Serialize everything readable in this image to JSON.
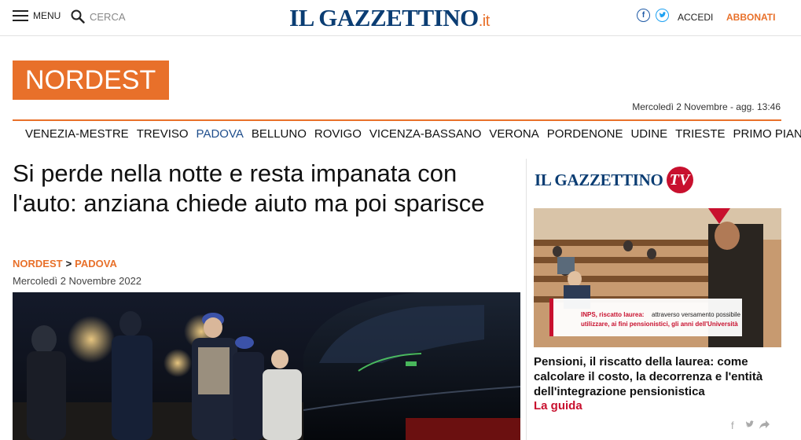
{
  "header": {
    "menu_label": "MENU",
    "search_placeholder": "CERCA",
    "logo_main": "IL GAZZETTINO",
    "logo_tld": ".it",
    "login_label": "ACCEDI",
    "subscribe_label": "ABBONATI"
  },
  "section": {
    "title": "NORDEST",
    "dateline": "Mercoledì 2 Novembre - agg. 13:46"
  },
  "subnav": {
    "items": [
      "VENEZIA-MESTRE",
      "TREVISO",
      "PADOVA",
      "BELLUNO",
      "ROVIGO",
      "VICENZA-BASSANO",
      "VERONA",
      "PORDENONE",
      "UDINE",
      "TRIESTE",
      "PRIMO PIANO"
    ],
    "active": "PADOVA"
  },
  "article": {
    "headline": "Si perde nella notte e resta impanata con l'auto: anziana chiede aiuto ma poi sparisce",
    "crumb_section": "NORDEST",
    "crumb_separator": ">",
    "crumb_sub": "PADOVA",
    "date": "Mercoledì 2 Novembre 2022"
  },
  "sidebar": {
    "tv_logo_text": "IL GAZZETTINO",
    "tv_badge": "TV",
    "video_overlay_bold": "INPS, riscatto laurea:",
    "video_overlay_text": "attraverso versamento possibile",
    "video_overlay_line2": "utilizzare, ai fini pensionistici, gli anni dell'Università",
    "video_caption": "Pensioni, il riscatto della laurea: come calcolare il costo, la decorrenza e l'entità dell'integrazione pensionistica",
    "video_tag": "La guida"
  },
  "colors": {
    "accent": "#e8702a",
    "brand_blue": "#0b3d73",
    "tv_red": "#c8102e"
  }
}
